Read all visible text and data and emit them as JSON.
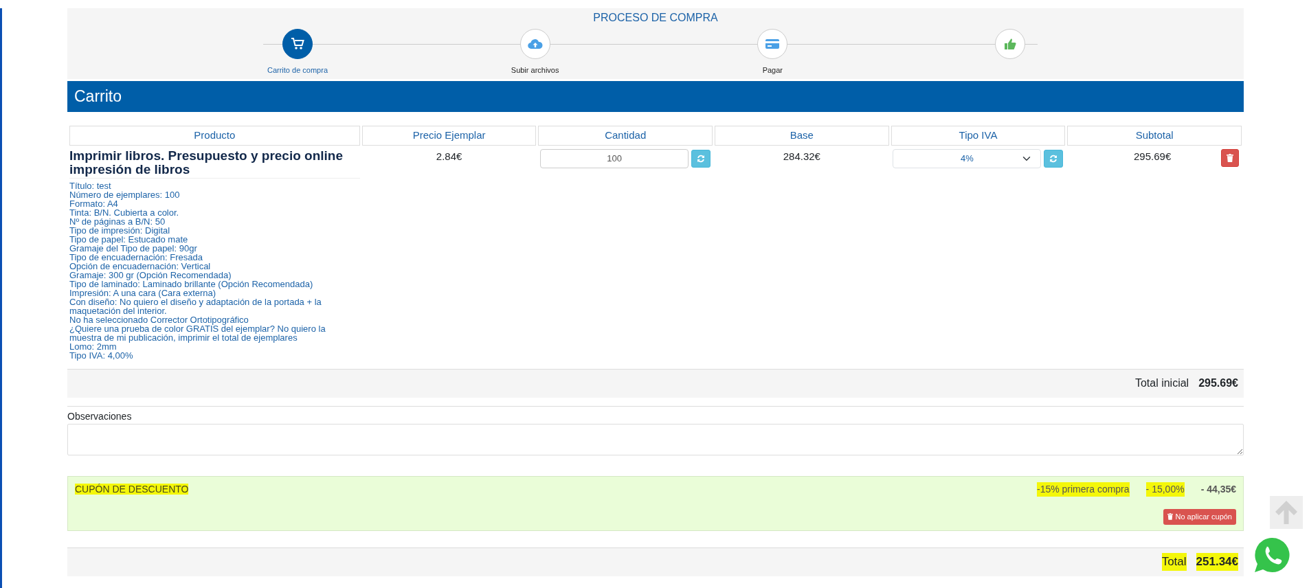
{
  "progress": {
    "title": "PROCESO DE COMPRA",
    "steps": [
      {
        "label": "Carrito de compra",
        "kind": "cart",
        "selected": true
      },
      {
        "label": "Subir archivos",
        "kind": "upload",
        "selected": false
      },
      {
        "label": "Pagar",
        "kind": "payment",
        "selected": false
      },
      {
        "kind": "done",
        "selected": false
      }
    ]
  },
  "section_title": "Carrito",
  "table": {
    "columns": [
      "Producto",
      "Precio Ejemplar",
      "Cantidad",
      "Base",
      "Tipo IVA",
      "Subtotal"
    ],
    "rows": [
      {
        "product": "Imprimir libros. Presupuesto y precio online impresión de libros",
        "details": [
          "Título: test",
          "Número de ejemplares: 100",
          "Formato: A4",
          "Tinta: B/N. Cubierta a color.",
          "Nº de páginas a B/N: 50",
          "Tipo de impresión: Digital",
          "Tipo de papel: Estucado mate",
          "Gramaje del Tipo de papel: 90gr",
          "Tipo de encuadernación: Fresada",
          "Opción de encuadernación: Vertical",
          "Gramaje: 300 gr (Opción Recomendada)",
          "Tipo de laminado: Laminado brillante (Opción Recomendada)",
          "Impresión: A una cara (Cara externa)",
          "Con diseño: No quiero el diseño y adaptación de la portada + la maquetación del interior.",
          "No ha seleccionado Corrector Ortotipográfico",
          "¿Quiere una prueba de color GRATIS del ejemplar? No quiero la muestra de mi publicación, imprimir el total de ejemplares",
          "Lomo: 2mm",
          "Tipo IVA: 4,00%"
        ],
        "unit_price": "2.84€",
        "quantity": "100",
        "base": "284.32€",
        "vat": "4%",
        "subtotal": "295.69€"
      }
    ]
  },
  "total_initial": {
    "label": "Total inicial",
    "value": "295.69€"
  },
  "observations": {
    "label": "Observaciones"
  },
  "coupon": {
    "title": {
      "text": "CUPÓN DE DESCUENTO",
      "highlighted": true
    },
    "name": {
      "text": "-15% primera compra",
      "highlighted": true
    },
    "percent": {
      "text": "- 15,00%",
      "highlighted": true
    },
    "amount": {
      "text": "- 44,35€",
      "highlighted": false
    },
    "button": "No aplicar cupón"
  },
  "total": {
    "label": "Total",
    "value": "251.34€",
    "highlighted": true
  }
}
